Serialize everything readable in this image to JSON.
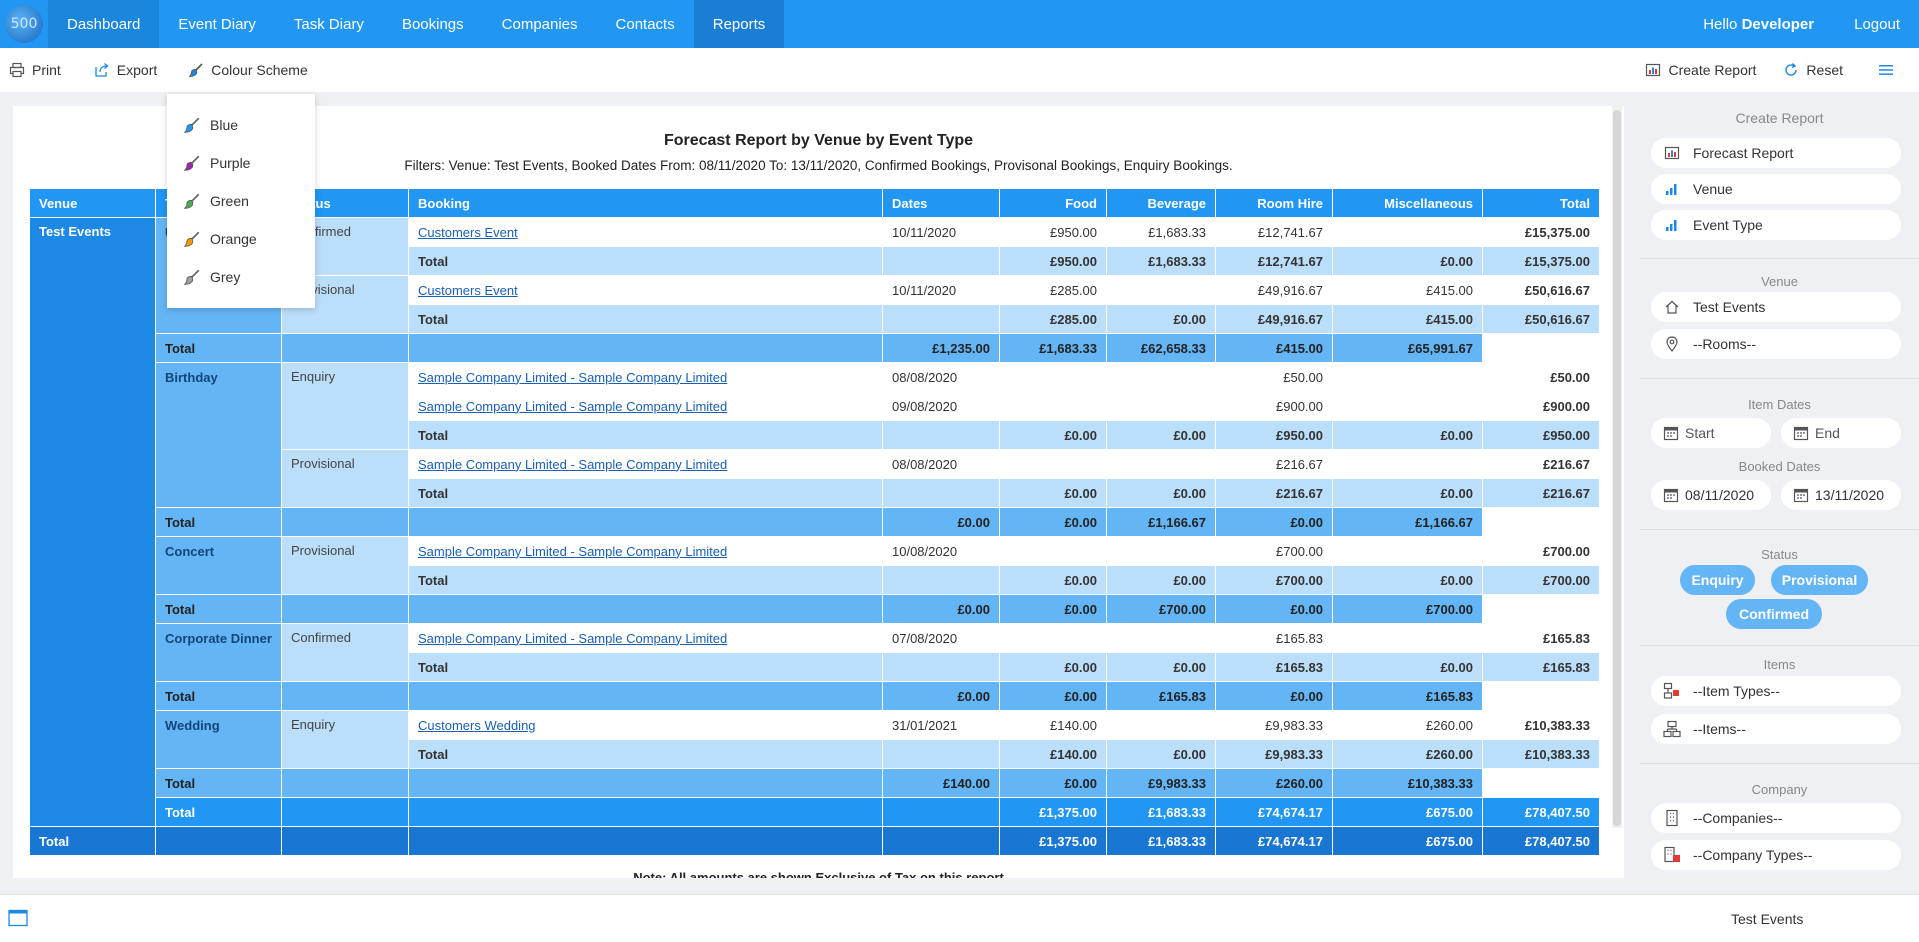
{
  "app": {
    "logo_text": "500"
  },
  "nav": {
    "items": [
      "Dashboard",
      "Event Diary",
      "Task Diary",
      "Bookings",
      "Companies",
      "Contacts",
      "Reports"
    ],
    "hello": "Hello",
    "user": "Developer",
    "logout": "Logout"
  },
  "toolbar": {
    "print": "Print",
    "export": "Export",
    "colour_scheme": "Colour Scheme",
    "create_report": "Create Report",
    "reset": "Reset"
  },
  "colour_menu": {
    "items": [
      {
        "label": "Blue",
        "color": "#2196f3"
      },
      {
        "label": "Purple",
        "color": "#9c27b0"
      },
      {
        "label": "Green",
        "color": "#4caf50"
      },
      {
        "label": "Orange",
        "color": "#ff9800"
      },
      {
        "label": "Grey",
        "color": "#9e9e9e"
      }
    ]
  },
  "report": {
    "title": "Forecast Report by Venue by Event Type",
    "filters": "Filters: Venue: Test Events, Booked Dates From: 08/11/2020 To: 13/11/2020, Confirmed Bookings, Provisonal Bookings, Enquiry Bookings.",
    "note": "Note: All amounts are shown Exclusive of Tax on this report",
    "columns": {
      "venue": "Venue",
      "type": "Type",
      "status": "Status",
      "booking": "Booking",
      "dates": "Dates",
      "food": "Food",
      "beverage": "Beverage",
      "room_hire": "Room Hire",
      "misc": "Miscellaneous",
      "total": "Total"
    },
    "total_label": "Total",
    "venue": "Test Events",
    "types": [
      {
        "name": "Unknown",
        "statuses": [
          {
            "name": "Confirmed",
            "rows": [
              {
                "booking": "Customers Event",
                "date": "10/11/2020",
                "food": "£950.00",
                "bev": "£1,683.33",
                "room": "£12,741.67",
                "misc": "",
                "total": "£15,375.00"
              }
            ],
            "total": {
              "food": "£950.00",
              "bev": "£1,683.33",
              "room": "£12,741.67",
              "misc": "£0.00",
              "total": "£15,375.00"
            }
          },
          {
            "name": "Provisional",
            "rows": [
              {
                "booking": "Customers Event",
                "date": "10/11/2020",
                "food": "£285.00",
                "bev": "",
                "room": "£49,916.67",
                "misc": "£415.00",
                "total": "£50,616.67"
              }
            ],
            "total": {
              "food": "£285.00",
              "bev": "£0.00",
              "room": "£49,916.67",
              "misc": "£415.00",
              "total": "£50,616.67"
            }
          }
        ],
        "total": {
          "food": "£1,235.00",
          "bev": "£1,683.33",
          "room": "£62,658.33",
          "misc": "£415.00",
          "total": "£65,991.67"
        }
      },
      {
        "name": "Birthday",
        "statuses": [
          {
            "name": "Enquiry",
            "rows": [
              {
                "booking": "Sample Company Limited - Sample Company Limited",
                "date": "08/08/2020",
                "food": "",
                "bev": "",
                "room": "£50.00",
                "misc": "",
                "total": "£50.00"
              },
              {
                "booking": "Sample Company Limited - Sample Company Limited",
                "date": "09/08/2020",
                "food": "",
                "bev": "",
                "room": "£900.00",
                "misc": "",
                "total": "£900.00"
              }
            ],
            "total": {
              "food": "£0.00",
              "bev": "£0.00",
              "room": "£950.00",
              "misc": "£0.00",
              "total": "£950.00"
            }
          },
          {
            "name": "Provisional",
            "rows": [
              {
                "booking": "Sample Company Limited - Sample Company Limited",
                "date": "08/08/2020",
                "food": "",
                "bev": "",
                "room": "£216.67",
                "misc": "",
                "total": "£216.67"
              }
            ],
            "total": {
              "food": "£0.00",
              "bev": "£0.00",
              "room": "£216.67",
              "misc": "£0.00",
              "total": "£216.67"
            }
          }
        ],
        "total": {
          "food": "£0.00",
          "bev": "£0.00",
          "room": "£1,166.67",
          "misc": "£0.00",
          "total": "£1,166.67"
        }
      },
      {
        "name": "Concert",
        "statuses": [
          {
            "name": "Provisional",
            "rows": [
              {
                "booking": "Sample Company Limited - Sample Company Limited",
                "date": "10/08/2020",
                "food": "",
                "bev": "",
                "room": "£700.00",
                "misc": "",
                "total": "£700.00"
              }
            ],
            "total": {
              "food": "£0.00",
              "bev": "£0.00",
              "room": "£700.00",
              "misc": "£0.00",
              "total": "£700.00"
            }
          }
        ],
        "total": {
          "food": "£0.00",
          "bev": "£0.00",
          "room": "£700.00",
          "misc": "£0.00",
          "total": "£700.00"
        }
      },
      {
        "name": "Corporate Dinner",
        "statuses": [
          {
            "name": "Confirmed",
            "rows": [
              {
                "booking": "Sample Company Limited - Sample Company Limited",
                "date": "07/08/2020",
                "food": "",
                "bev": "",
                "room": "£165.83",
                "misc": "",
                "total": "£165.83"
              }
            ],
            "total": {
              "food": "£0.00",
              "bev": "£0.00",
              "room": "£165.83",
              "misc": "£0.00",
              "total": "£165.83"
            }
          }
        ],
        "total": {
          "food": "£0.00",
          "bev": "£0.00",
          "room": "£165.83",
          "misc": "£0.00",
          "total": "£165.83"
        }
      },
      {
        "name": "Wedding",
        "statuses": [
          {
            "name": "Enquiry",
            "rows": [
              {
                "booking": "Customers Wedding",
                "date": "31/01/2021",
                "food": "£140.00",
                "bev": "",
                "room": "£9,983.33",
                "misc": "£260.00",
                "total": "£10,383.33"
              }
            ],
            "total": {
              "food": "£140.00",
              "bev": "£0.00",
              "room": "£9,983.33",
              "misc": "£260.00",
              "total": "£10,383.33"
            }
          }
        ],
        "total": {
          "food": "£140.00",
          "bev": "£0.00",
          "room": "£9,983.33",
          "misc": "£260.00",
          "total": "£10,383.33"
        }
      }
    ],
    "venue_total": {
      "food": "£1,375.00",
      "bev": "£1,683.33",
      "room": "£74,674.17",
      "misc": "£675.00",
      "total": "£78,407.50"
    },
    "grand_total": {
      "food": "£1,375.00",
      "bev": "£1,683.33",
      "room": "£74,674.17",
      "misc": "£675.00",
      "total": "£78,407.50"
    }
  },
  "sidebar": {
    "create_report": {
      "heading": "Create Report",
      "items": [
        "Forecast Report",
        "Venue",
        "Event Type"
      ]
    },
    "venue": {
      "heading": "Venue",
      "value": "Test Events",
      "rooms": "--Rooms--"
    },
    "item_dates": {
      "heading": "Item Dates",
      "start": "Start",
      "end": "End"
    },
    "booked_dates": {
      "heading": "Booked Dates",
      "from": "08/11/2020",
      "to": "13/11/2020"
    },
    "status": {
      "heading": "Status",
      "enquiry": "Enquiry",
      "provisional": "Provisional",
      "confirmed": "Confirmed"
    },
    "items": {
      "heading": "Items",
      "item_types": "--Item Types--",
      "items": "--Items--"
    },
    "company": {
      "heading": "Company",
      "companies": "--Companies--",
      "company_types": "--Company Types--"
    }
  },
  "footer": {
    "venue": "Test Events"
  }
}
